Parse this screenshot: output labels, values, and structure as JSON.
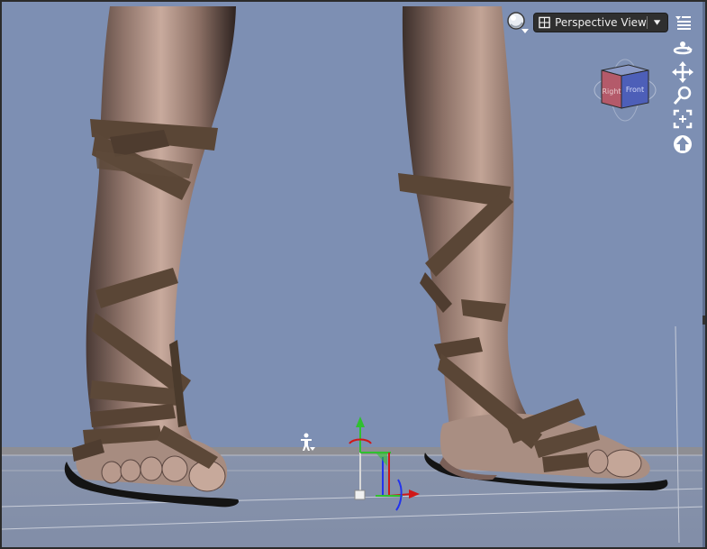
{
  "viewport": {
    "view_label": "Perspective View",
    "background_color": "#7d8fb3",
    "floor_color": "#8e8e92"
  },
  "nav_cube": {
    "left_face": "Right",
    "front_face": "Front",
    "left_face_color": "#b45a6a",
    "front_face_color": "#4d5fb8"
  },
  "icons": {
    "shading": "shading-sphere-icon",
    "view_menu": "view-menu-icon",
    "orbit": "orbit-icon",
    "pan": "pan-icon",
    "zoom": "zoom-icon",
    "frame": "frame-selection-icon",
    "reset": "reset-view-icon",
    "figure": "figure-pick-icon"
  },
  "scene": {
    "skin_color": "#9b7f73",
    "strap_color": "#5a4636",
    "sole_color": "#141414"
  }
}
